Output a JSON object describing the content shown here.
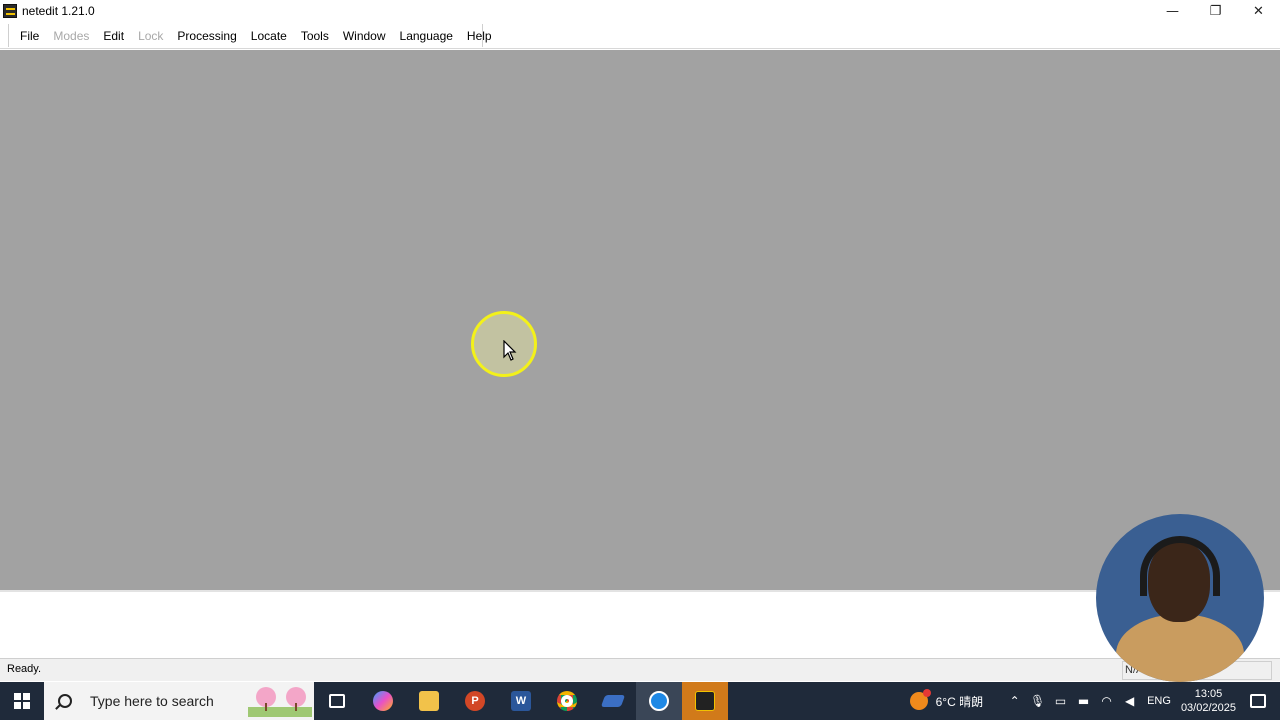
{
  "window": {
    "title": "netedit 1.21.0",
    "controls": {
      "minimize": "—",
      "restore": "❐",
      "close": "✕"
    }
  },
  "menu": {
    "items": [
      {
        "label": "File",
        "enabled": true
      },
      {
        "label": "Modes",
        "enabled": false
      },
      {
        "label": "Edit",
        "enabled": true
      },
      {
        "label": "Lock",
        "enabled": false
      },
      {
        "label": "Processing",
        "enabled": true
      },
      {
        "label": "Locate",
        "enabled": true
      },
      {
        "label": "Tools",
        "enabled": true
      },
      {
        "label": "Window",
        "enabled": true
      },
      {
        "label": "Language",
        "enabled": true
      },
      {
        "label": "Help",
        "enabled": true
      }
    ]
  },
  "canvas": {
    "background": "#a2a2a2"
  },
  "status": {
    "text": "Ready.",
    "right_text": "N/A"
  },
  "taskbar": {
    "search_placeholder": "Type here to search",
    "apps": [
      "task-view",
      "copilot",
      "file-explorer",
      "powerpoint",
      "word",
      "chrome",
      "app",
      "browser-app",
      "netedit"
    ],
    "weather": "6°C 晴朗",
    "tray_icons": [
      "chevron-up",
      "microphone",
      "tablet",
      "battery",
      "wifi",
      "volume"
    ],
    "language": "ENG",
    "time": "13:05",
    "date": "03/02/2025"
  },
  "colors": {
    "taskbar": "#1f2a3a",
    "cursor_highlight": "#f3f11a",
    "active_app": "#d17a1a"
  }
}
